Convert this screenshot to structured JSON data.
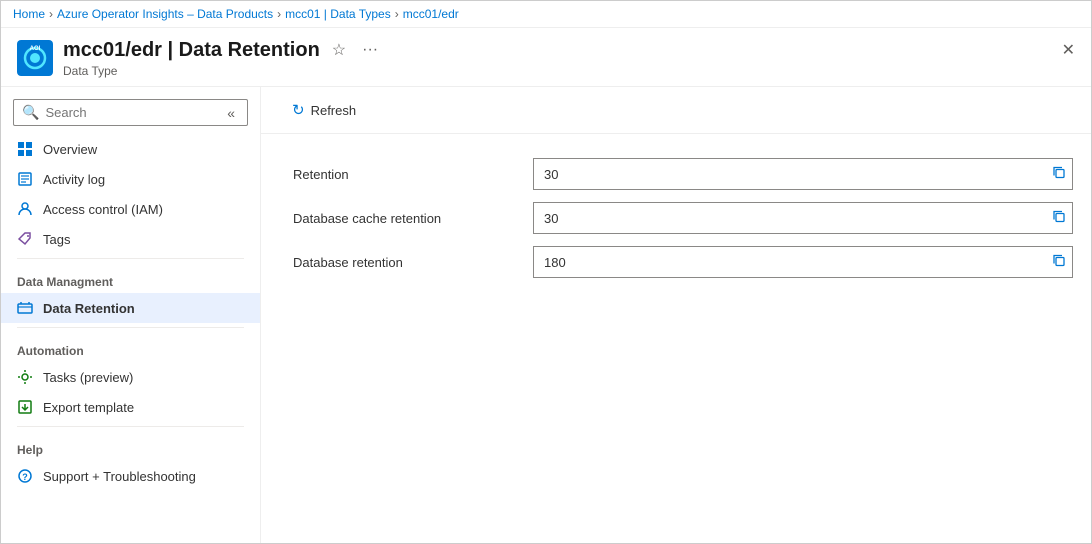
{
  "breadcrumb": {
    "items": [
      {
        "label": "Home",
        "href": "#"
      },
      {
        "label": "Azure Operator Insights – Data Products",
        "href": "#"
      },
      {
        "label": "mcc01 | Data Types",
        "href": "#"
      },
      {
        "label": "mcc01/edr",
        "href": "#"
      }
    ]
  },
  "header": {
    "title": "mcc01/edr | Data Retention",
    "subtitle": "Data Type",
    "star_label": "☆",
    "more_label": "···",
    "close_label": "✕"
  },
  "sidebar": {
    "search_placeholder": "Search",
    "collapse_icon": "«",
    "nav_items": [
      {
        "id": "overview",
        "label": "Overview",
        "icon": "overview"
      },
      {
        "id": "activity-log",
        "label": "Activity log",
        "icon": "activity"
      },
      {
        "id": "access-control",
        "label": "Access control (IAM)",
        "icon": "iam"
      },
      {
        "id": "tags",
        "label": "Tags",
        "icon": "tags"
      }
    ],
    "sections": [
      {
        "title": "Data Managment",
        "items": [
          {
            "id": "data-retention",
            "label": "Data Retention",
            "icon": "retention",
            "active": true
          }
        ]
      },
      {
        "title": "Automation",
        "items": [
          {
            "id": "tasks",
            "label": "Tasks (preview)",
            "icon": "tasks"
          },
          {
            "id": "export-template",
            "label": "Export template",
            "icon": "export"
          }
        ]
      },
      {
        "title": "Help",
        "items": [
          {
            "id": "support",
            "label": "Support + Troubleshooting",
            "icon": "support"
          }
        ]
      }
    ]
  },
  "toolbar": {
    "refresh_label": "Refresh"
  },
  "fields": [
    {
      "label": "Retention",
      "value": "30"
    },
    {
      "label": "Database cache retention",
      "value": "30"
    },
    {
      "label": "Database retention",
      "value": "180"
    }
  ],
  "icons": {
    "search": "🔍",
    "overview": "⊞",
    "activity": "📋",
    "iam": "👤",
    "tags": "🏷",
    "retention": "📊",
    "tasks": "⚙",
    "export": "⬇",
    "support": "ℹ",
    "refresh": "↻",
    "copy": "⧉",
    "star": "☆",
    "more": "···",
    "close": "✕",
    "collapse": "«"
  }
}
